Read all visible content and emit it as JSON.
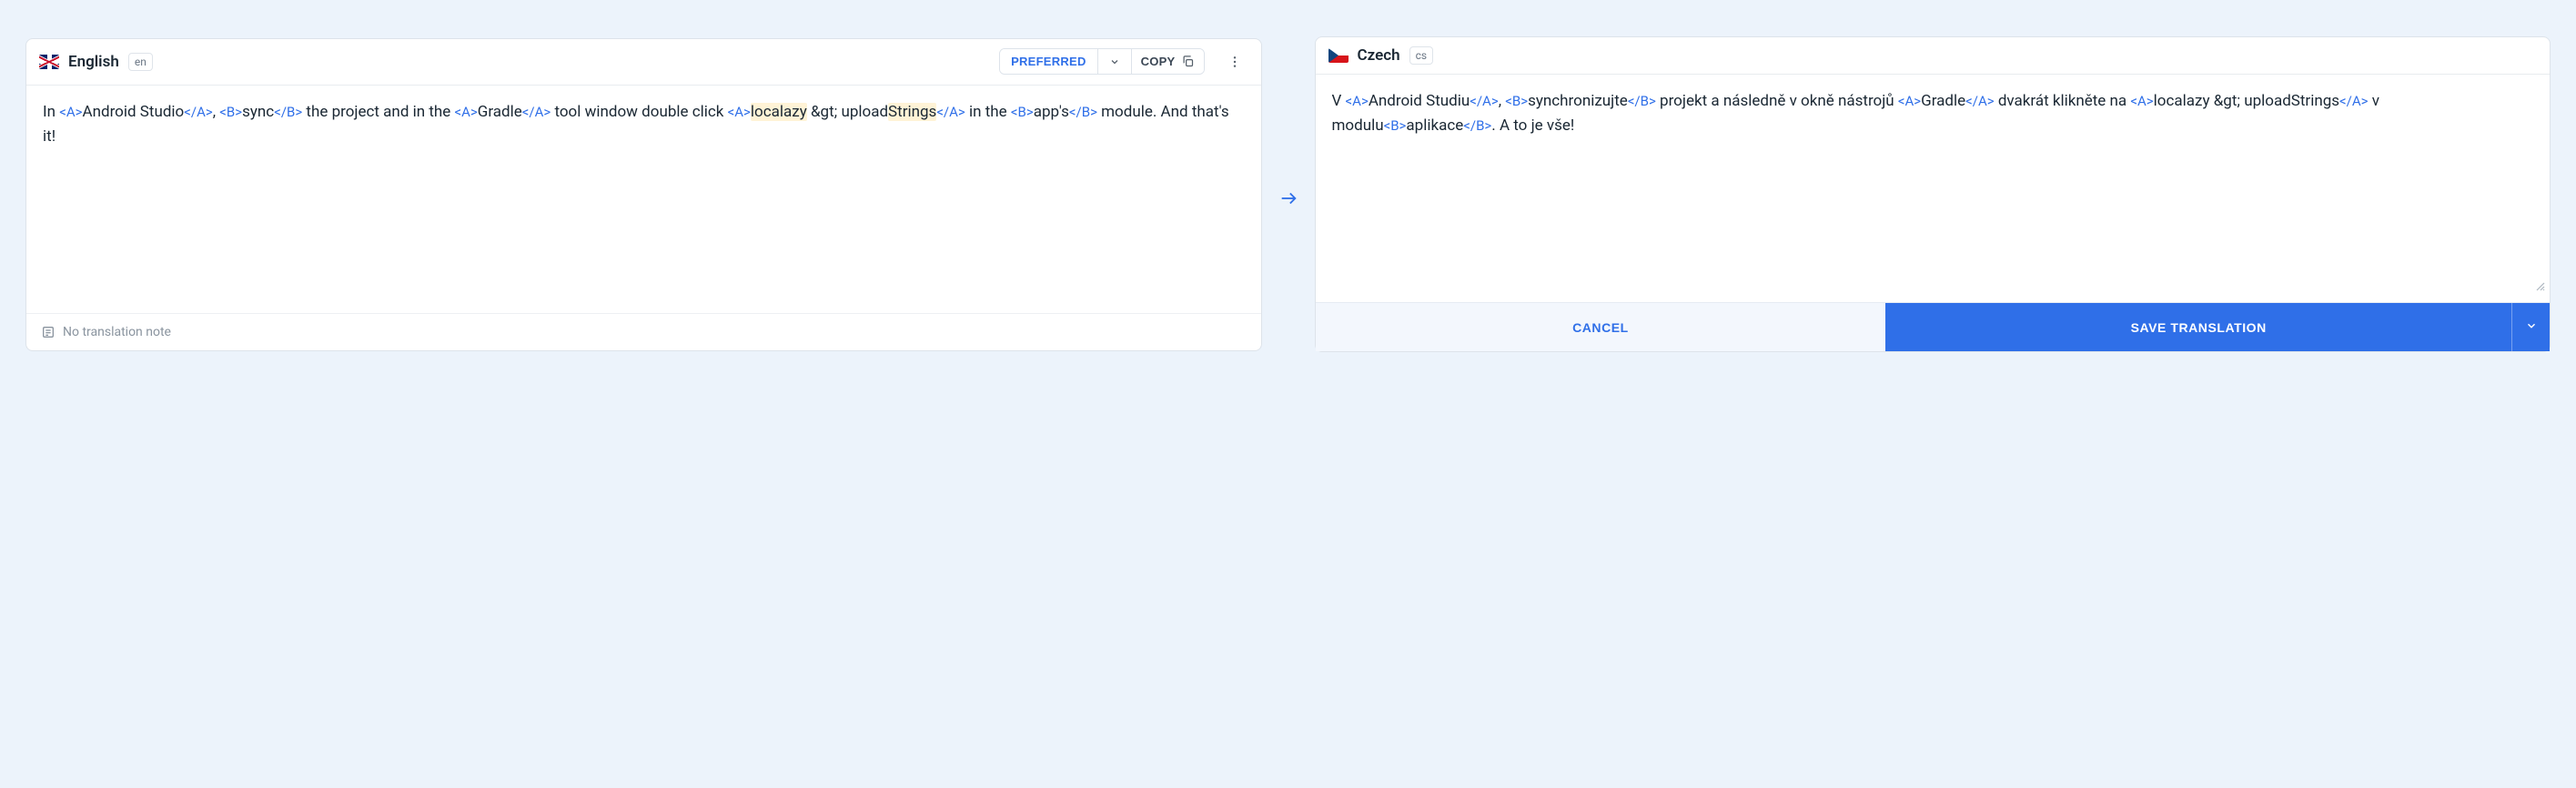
{
  "source": {
    "language": "English",
    "code": "en",
    "text_segments": [
      {
        "t": "In "
      },
      {
        "t": "<A>",
        "cls": "tag"
      },
      {
        "t": "Android Studio"
      },
      {
        "t": "</A>",
        "cls": "tag"
      },
      {
        "t": ", "
      },
      {
        "t": "<B>",
        "cls": "tag"
      },
      {
        "t": "sync"
      },
      {
        "t": "</B>",
        "cls": "tag"
      },
      {
        "t": " the project and in the "
      },
      {
        "t": "<A>",
        "cls": "tag"
      },
      {
        "t": "Gradle"
      },
      {
        "t": "</A>",
        "cls": "tag"
      },
      {
        "t": " tool window double click "
      },
      {
        "t": "<A>",
        "cls": "tag"
      },
      {
        "t": "localazy",
        "cls": "hl"
      },
      {
        "t": " &gt; upload"
      },
      {
        "t": "Strings",
        "cls": "hl"
      },
      {
        "t": "</A>",
        "cls": "tag"
      },
      {
        "t": " in the "
      },
      {
        "t": "<B>",
        "cls": "tag"
      },
      {
        "t": "app's"
      },
      {
        "t": "</B>",
        "cls": "tag"
      },
      {
        "t": " module. And that's it!"
      }
    ],
    "preferred_label": "PREFERRED",
    "copy_label": "COPY",
    "note_placeholder": "No translation note"
  },
  "target": {
    "language": "Czech",
    "code": "cs",
    "text_segments": [
      {
        "t": "V "
      },
      {
        "t": "<A>",
        "cls": "tag"
      },
      {
        "t": "Android Studiu"
      },
      {
        "t": "</A>",
        "cls": "tag"
      },
      {
        "t": ", "
      },
      {
        "t": "<B>",
        "cls": "tag"
      },
      {
        "t": "synchronizujte"
      },
      {
        "t": "</B>",
        "cls": "tag"
      },
      {
        "t": " projekt a následně v okně nástrojů "
      },
      {
        "t": "<A>",
        "cls": "tag"
      },
      {
        "t": "Gradle"
      },
      {
        "t": "</A>",
        "cls": "tag"
      },
      {
        "t": " dvakrát klikněte na "
      },
      {
        "t": "<A>",
        "cls": "tag"
      },
      {
        "t": "localazy &gt; uploadStrings"
      },
      {
        "t": "</A>",
        "cls": "tag"
      },
      {
        "t": " v modulu"
      },
      {
        "t": "<B>",
        "cls": "tag"
      },
      {
        "t": "aplikace"
      },
      {
        "t": "</B>",
        "cls": "tag"
      },
      {
        "t": ". A to je vše!"
      }
    ]
  },
  "actions": {
    "cancel": "CANCEL",
    "save": "SAVE TRANSLATION"
  }
}
